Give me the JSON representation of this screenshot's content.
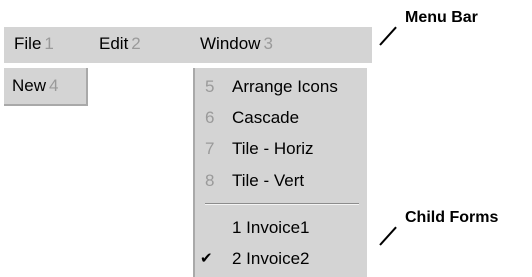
{
  "menubar": {
    "items": [
      {
        "label": "File",
        "accel": "1"
      },
      {
        "label": "Edit",
        "accel": "2"
      },
      {
        "label": "Window",
        "accel": "3"
      }
    ]
  },
  "file_menu": {
    "items": [
      {
        "label": "New",
        "accel": "4"
      }
    ]
  },
  "window_menu": {
    "items": [
      {
        "label": "Arrange Icons",
        "accel": "5"
      },
      {
        "label": "Cascade",
        "accel": "6"
      },
      {
        "label": "Tile - Horiz",
        "accel": "7"
      },
      {
        "label": "Tile - Vert",
        "accel": "8"
      }
    ],
    "child_forms": [
      {
        "label": "1 Invoice1",
        "checked": false
      },
      {
        "label": "2 Invoice2",
        "checked": true
      }
    ]
  },
  "annotations": {
    "menu_bar": "Menu Bar",
    "child_forms": "Child Forms"
  },
  "icons": {
    "check": "checkmark-icon"
  },
  "colors": {
    "menu_bg": "#d4d4d4",
    "accel_gray": "#9a9a9a"
  }
}
